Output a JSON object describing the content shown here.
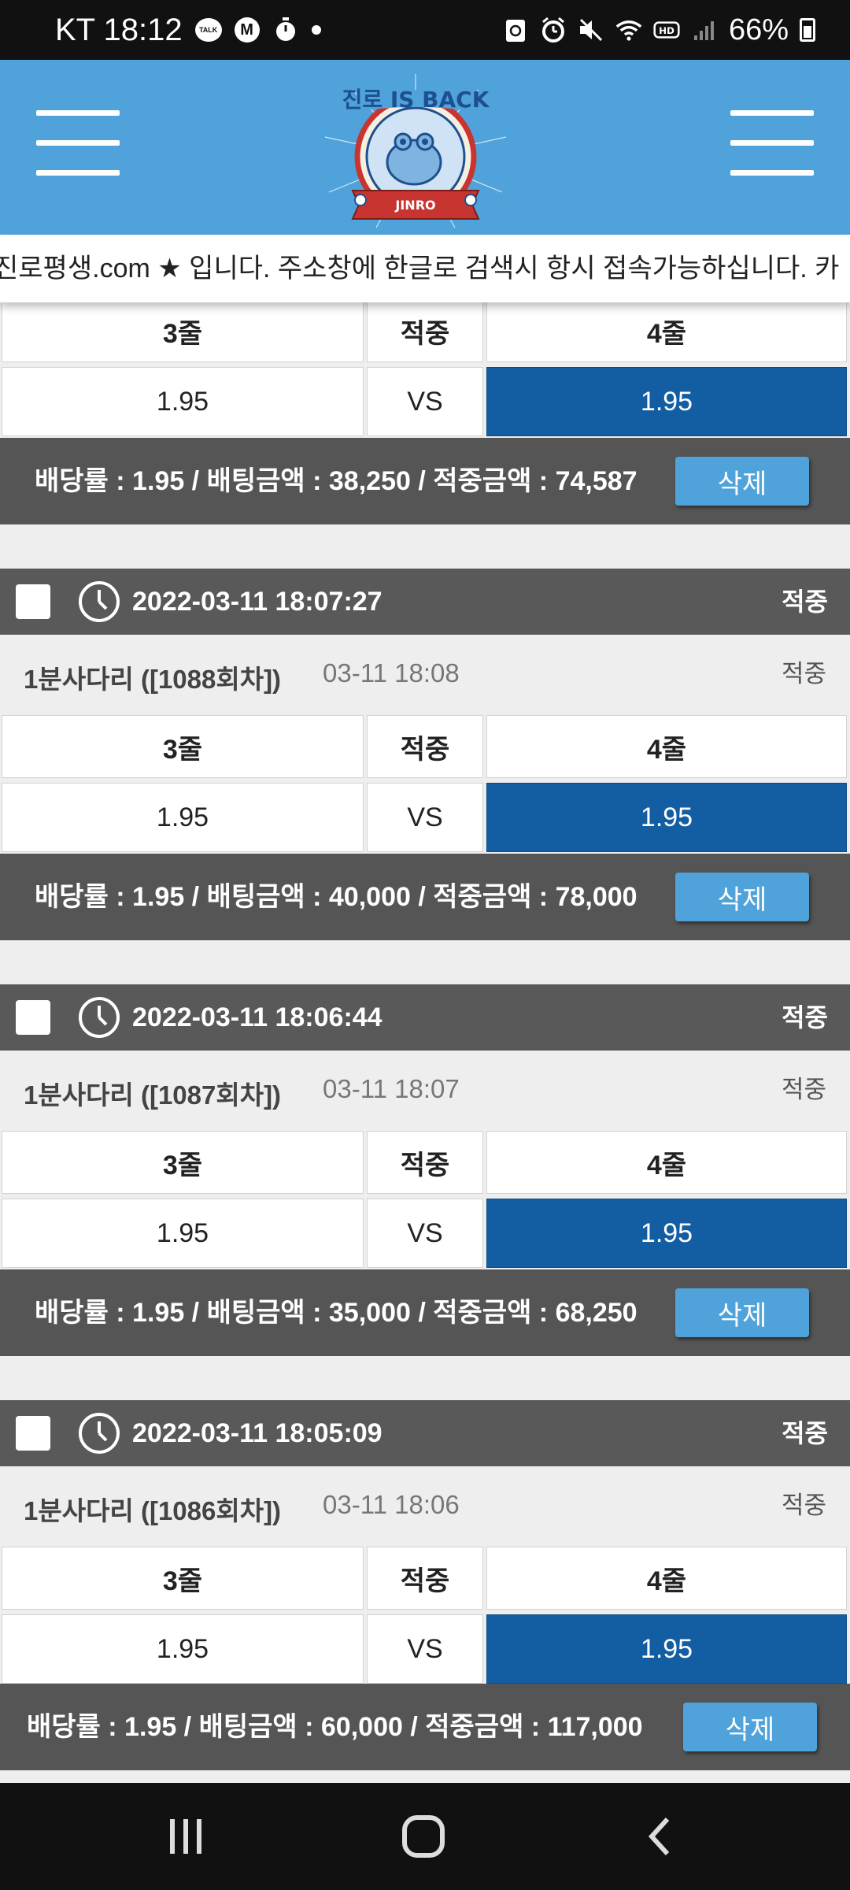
{
  "status_bar": {
    "carrier_time": "KT 18:12",
    "talk_icon_text": "TALK",
    "m_icon_text": "M",
    "battery": "66%"
  },
  "header": {
    "logo_title": "진로 IS BACK",
    "logo_brand": "JINRO"
  },
  "marquee_text": "진로평생.com ★ 입니다. 주소창에 한글로 검색시 항시 접속가능하십니다. 카",
  "first_bet_partial": {
    "grid_header": [
      "3줄",
      "적중",
      "4줄"
    ],
    "grid_values": [
      "1.95",
      "VS",
      "1.95"
    ],
    "summary": "배당률 : 1.95 / 배팅금액 : 38,250 / 적중금액 : 74,587",
    "delete_label": "삭제"
  },
  "bets": [
    {
      "datetime": "2022-03-11 18:07:27",
      "status": "적중",
      "game_name": "1분사다리 ([1088회차])",
      "game_time": "03-11 18:08",
      "game_status": "적중",
      "grid_header": [
        "3줄",
        "적중",
        "4줄"
      ],
      "grid_values": [
        "1.95",
        "VS",
        "1.95"
      ],
      "summary": "배당률 : 1.95 / 배팅금액 : 40,000 / 적중금액 : 78,000",
      "delete_label": "삭제"
    },
    {
      "datetime": "2022-03-11 18:06:44",
      "status": "적중",
      "game_name": "1분사다리 ([1087회차])",
      "game_time": "03-11 18:07",
      "game_status": "적중",
      "grid_header": [
        "3줄",
        "적중",
        "4줄"
      ],
      "grid_values": [
        "1.95",
        "VS",
        "1.95"
      ],
      "summary": "배당률 : 1.95 / 배팅금액 : 35,000 / 적중금액 : 68,250",
      "delete_label": "삭제"
    },
    {
      "datetime": "2022-03-11 18:05:09",
      "status": "적중",
      "game_name": "1분사다리 ([1086회차])",
      "game_time": "03-11 18:06",
      "game_status": "적중",
      "grid_header": [
        "3줄",
        "적중",
        "4줄"
      ],
      "grid_values": [
        "1.95",
        "VS",
        "1.95"
      ],
      "summary": "배당률 : 1.95 / 배팅금액 : 60,000 / 적중금액 : 117,000",
      "delete_label": "삭제"
    }
  ],
  "colors": {
    "header_bg": "#4fa3da",
    "selected_cell": "#135ea3",
    "summary_bg": "#555555",
    "delete_button": "#4fa3da"
  },
  "icons": [
    "talk-icon",
    "m-icon",
    "timer-icon",
    "recycle-icon",
    "alarm-icon",
    "mute-icon",
    "wifi-icon",
    "hd-icon",
    "signal-icon",
    "battery-icon",
    "menu-icon",
    "clock-icon",
    "recent-apps-icon",
    "home-icon",
    "back-icon"
  ]
}
